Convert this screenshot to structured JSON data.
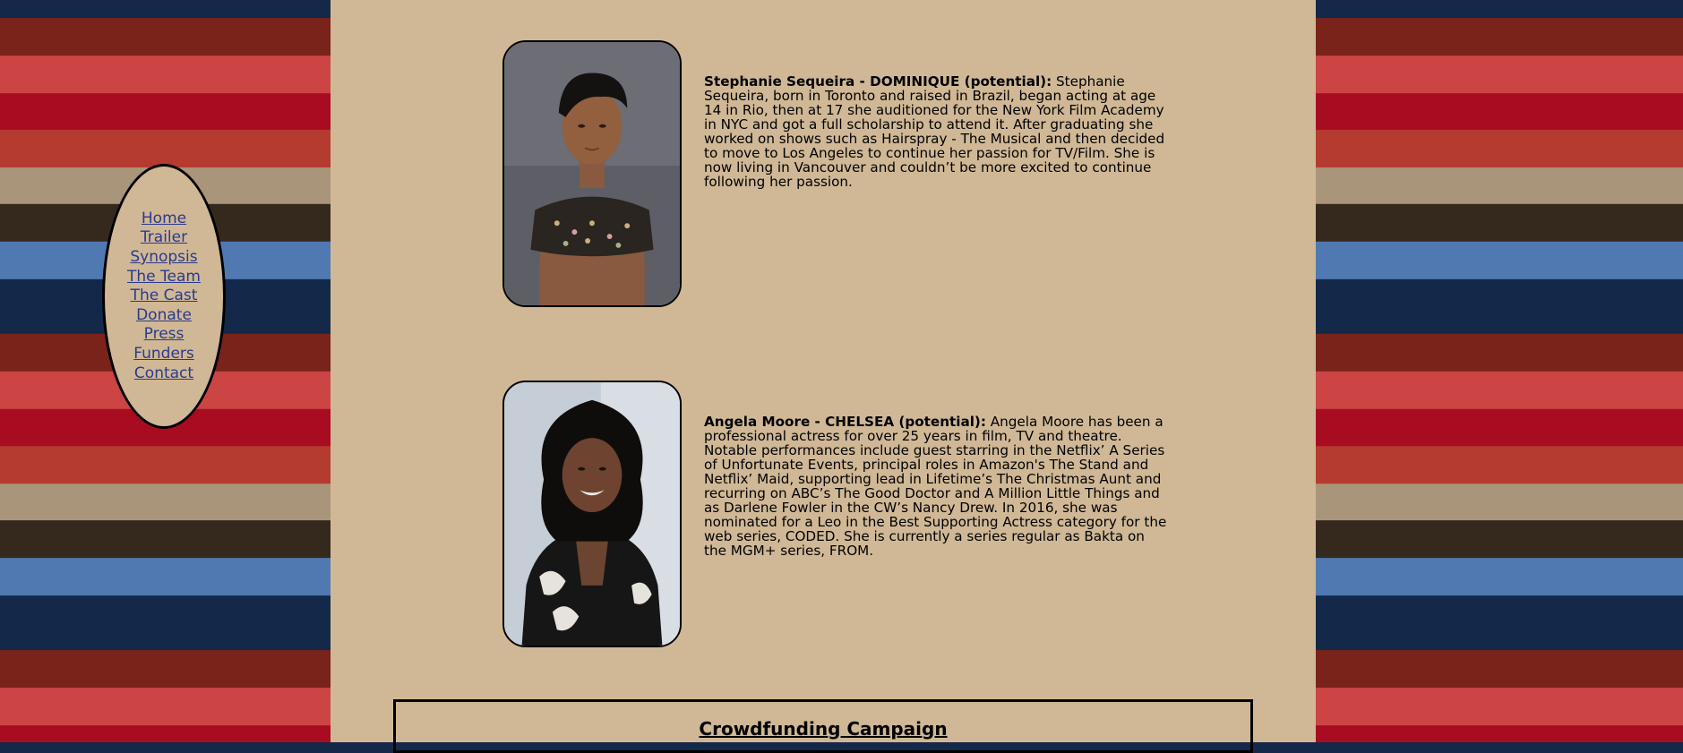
{
  "nav": {
    "items": [
      {
        "label": "Home"
      },
      {
        "label": "Trailer"
      },
      {
        "label": "Synopsis"
      },
      {
        "label": "The Team"
      },
      {
        "label": "The Cast"
      },
      {
        "label": "Donate"
      },
      {
        "label": "Press"
      },
      {
        "label": "Funders"
      },
      {
        "label": "Contact"
      }
    ]
  },
  "cast": [
    {
      "name_role": "Stephanie Sequeira - DOMINIQUE (potential):",
      "bio": " Stephanie Sequeira, born in Toronto and raised in Brazil, began acting at age 14 in Rio, then at 17 she auditioned for the New York Film Academy in NYC and got a full scholarship to attend it. After graduating she worked on shows such as Hairspray - The Musical and then decided to move to Los Angeles to continue her passion for TV/Film. She is now living in Vancouver and couldn’t be more excited to continue following her passion."
    },
    {
      "name_role": "Angela Moore - CHELSEA (potential):",
      "bio": " Angela Moore has been a professional actress for over 25 years in film, TV and theatre. Notable performances include guest starring in the Netflix’ A Series of Unfortunate Events, principal roles in Amazon's The Stand and Netflix’ Maid, supporting lead in Lifetime’s The Christmas Aunt and recurring on ABC’s The Good Doctor and A Million Little Things and as Darlene Fowler in the CW’s Nancy Drew. In 2016, she was nominated for a Leo in the Best Supporting Actress category for the web series, CODED. She is currently a series regular as Bakta on the MGM+ series, FROM."
    }
  ],
  "crowdfunding": {
    "title": "Crowdfunding Campaign"
  },
  "colors": {
    "page_bg": "#d0b896",
    "link": "#2b3a8c",
    "stripes": [
      "#14284a",
      "#7a231a",
      "#cc4444",
      "#a80c20",
      "#b53a30",
      "#a99579",
      "#35291e",
      "#5079b2"
    ]
  }
}
